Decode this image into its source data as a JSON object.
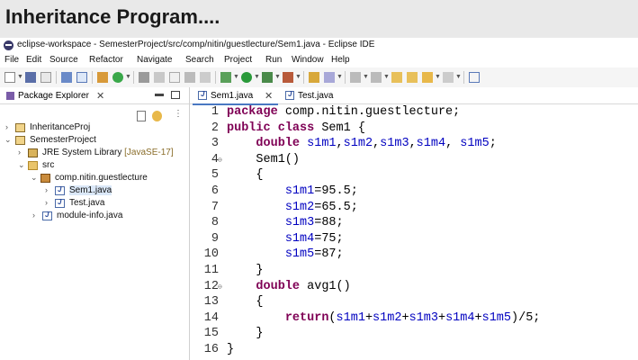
{
  "banner": {
    "title": "Inheritance Program...."
  },
  "window": {
    "title": "eclipse-workspace - SemesterProject/src/comp/nitin/guestlecture/Sem1.java - Eclipse IDE"
  },
  "menu": [
    "File",
    "Edit",
    "Source",
    "Refactor",
    "Navigate",
    "Search",
    "Project",
    "Run",
    "Window",
    "Help"
  ],
  "package_explorer": {
    "title": "Package Explorer",
    "tree": [
      {
        "label": "InheritanceProj"
      },
      {
        "label": "SemesterProject"
      },
      {
        "label": "JRE System Library",
        "suffix": "[JavaSE-17]"
      },
      {
        "label": "src"
      },
      {
        "label": "comp.nitin.guestlecture"
      },
      {
        "label": "Sem1.java"
      },
      {
        "label": "Test.java"
      },
      {
        "label": "module-info.java"
      }
    ]
  },
  "editor": {
    "tabs": [
      {
        "label": "Sem1.java",
        "active": true
      },
      {
        "label": "Test.java",
        "active": false
      }
    ],
    "line_numbers": [
      "1",
      "2",
      "3",
      "4",
      "5",
      "6",
      "7",
      "8",
      "9",
      "10",
      "11",
      "12",
      "13",
      "14",
      "15",
      "16"
    ]
  },
  "colors": {
    "keyword": "#7f0055",
    "field": "#0000c0",
    "banner_bg": "#e9e9e9",
    "selection": "#dbe8f8"
  }
}
